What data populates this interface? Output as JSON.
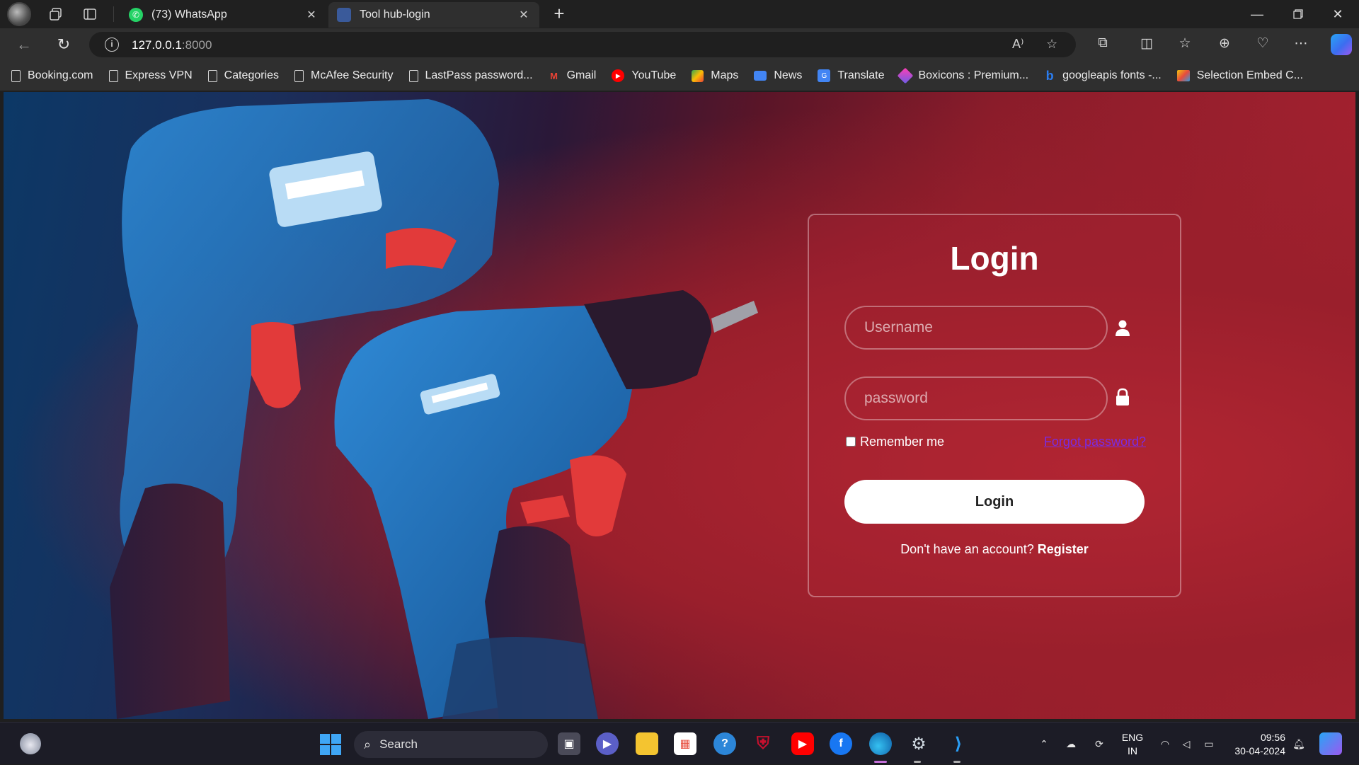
{
  "browser": {
    "tabs": [
      {
        "title": "(73) WhatsApp",
        "active": false
      },
      {
        "title": "Tool hub-login",
        "active": true
      }
    ],
    "address": {
      "host": "127.0.0.1",
      "port": ":8000"
    },
    "bookmarks": [
      {
        "label": "Booking.com",
        "icon": "page-icon"
      },
      {
        "label": "Express VPN",
        "icon": "page-icon"
      },
      {
        "label": "Categories",
        "icon": "page-icon"
      },
      {
        "label": "McAfee Security",
        "icon": "page-icon"
      },
      {
        "label": "LastPass password...",
        "icon": "page-icon"
      },
      {
        "label": "Gmail",
        "icon": "gmail-icon"
      },
      {
        "label": "YouTube",
        "icon": "youtube-icon"
      },
      {
        "label": "Maps",
        "icon": "maps-icon"
      },
      {
        "label": "News",
        "icon": "news-icon"
      },
      {
        "label": "Translate",
        "icon": "translate-icon"
      },
      {
        "label": "Boxicons : Premium...",
        "icon": "boxicons-icon"
      },
      {
        "label": "googleapis fonts -...",
        "icon": "bing-icon"
      },
      {
        "label": "Selection Embed C...",
        "icon": "selection-icon"
      }
    ]
  },
  "login": {
    "title": "Login",
    "username_placeholder": "Username",
    "password_placeholder": "password",
    "remember_label": "Remember me",
    "forgot_label": "Forgot password?",
    "button_label": "Login",
    "register_prompt": "Don't have an account?",
    "register_label": "Register"
  },
  "taskbar": {
    "search_label": "Search",
    "language": {
      "line1": "ENG",
      "line2": "IN"
    },
    "time": "09:56",
    "date": "30-04-2024"
  },
  "colors": {
    "accent": "#ffffff",
    "forgot_link": "#7a2be2",
    "background_red": "#a82230",
    "background_blue": "#0c3866"
  }
}
